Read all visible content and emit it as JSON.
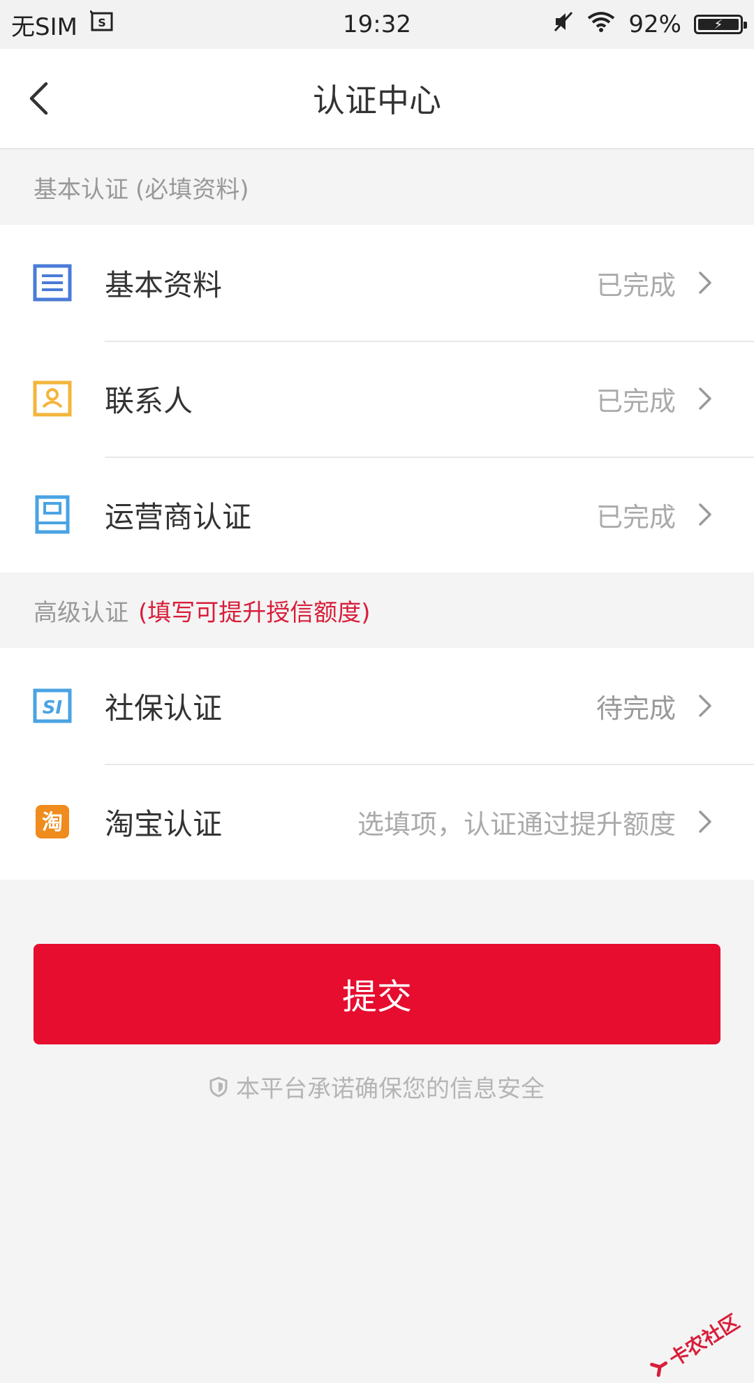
{
  "status_bar": {
    "carrier": "无SIM",
    "time": "19:32",
    "battery": "92%",
    "icons": [
      "sim-card-icon",
      "mute-icon",
      "wifi-icon",
      "battery-icon"
    ]
  },
  "header": {
    "title": "认证中心",
    "back_icon": "chevron-left-icon"
  },
  "basic_section": {
    "title": "基本认证",
    "subtitle": "(必填资料)",
    "items": [
      {
        "label": "基本资料",
        "status": "已完成",
        "icon": "document-icon",
        "color": "#4a7bd8"
      },
      {
        "label": "联系人",
        "status": "已完成",
        "icon": "contact-card-icon",
        "color": "#f3b53c"
      },
      {
        "label": "运营商认证",
        "status": "已完成",
        "icon": "phone-icon",
        "color": "#4aa3e3"
      }
    ]
  },
  "advanced_section": {
    "title": "高级认证",
    "highlight": "(填写可提升授信额度)",
    "highlight_color": "#d81e3a",
    "items": [
      {
        "label": "社保认证",
        "status": "待完成",
        "icon": "social-insurance-icon",
        "color": "#4aa3e3",
        "icon_text": "SI"
      },
      {
        "label": "淘宝认证",
        "status": "选填项，认证通过提升额度",
        "icon": "taobao-icon",
        "color": "#f08b1d",
        "icon_text": "淘"
      }
    ]
  },
  "submit": {
    "label": "提交",
    "color": "#e60d2f"
  },
  "security_note": {
    "text": "本平台承诺确保您的信息安全",
    "icon": "shield-icon"
  },
  "watermark": {
    "text": "卡农社区"
  }
}
